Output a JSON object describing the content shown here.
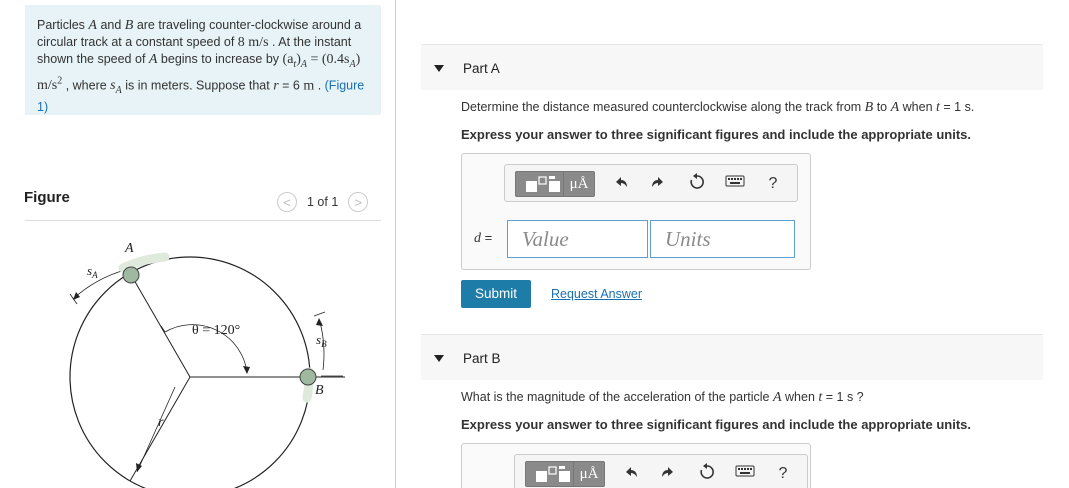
{
  "problem": {
    "t1": "Particles ",
    "A": "A",
    "t2": " and ",
    "B": "B",
    "t3": " are traveling counter-clockwise around a circular track at a constant speed of ",
    "speed": "8  m/s",
    "t4": " . At the instant shown the speed of ",
    "A2": "A",
    "t5": " begins to increase by ",
    "eq": "(a",
    "eq_sub": "t",
    "eq2": ")",
    "eq_sub2": "A",
    "eq3": " = (0.4s",
    "eq_sub3": "A",
    "eq4": ") m/s",
    "eq_sup": "2",
    "t6": " , where ",
    "sA": "s",
    "sA_sub": "A",
    "t7": " is in meters. Suppose that ",
    "r": "r",
    "t8": " = 6  ",
    "r_unit": "m",
    "t9": " . ",
    "figure_link": "(Figure 1)"
  },
  "figure": {
    "label": "Figure",
    "pager": "1 of 1",
    "prev_glyph": "<",
    "next_glyph": ">",
    "label_A": "A",
    "label_B": "B",
    "label_sA": "s",
    "label_sA_sub": "A",
    "label_sB": "s",
    "label_sB_sub": "B",
    "label_r": "r",
    "label_theta": "θ = 120°"
  },
  "part_a": {
    "title": "Part A",
    "q1": "Determine the distance measured counterclockwise along the track from ",
    "q_B": "B",
    "q2": " to ",
    "q_A": "A",
    "q3": " when ",
    "q_t": "t",
    "q4": " = 1 s.",
    "instruction": "Express your answer to three significant figures and include the appropriate units.",
    "var": "d",
    "var_eq": " =",
    "value_placeholder": "Value",
    "units_placeholder": "Units",
    "submit": "Submit",
    "request_answer": "Request Answer"
  },
  "part_b": {
    "title": "Part B",
    "q1": "What is the magnitude of the acceleration of the particle ",
    "q_A": "A",
    "q2": " when ",
    "q_t": "t",
    "q3": " = 1 s ?",
    "instruction": "Express your answer to three significant figures and include the appropriate units."
  },
  "toolbar": {
    "mu_label": "μÅ",
    "help": "?"
  },
  "colors": {
    "panel_bg": "#e7f3f6",
    "link": "#1a6fb0",
    "submit_bg": "#1d7ca8",
    "field_border": "#5c9fd0",
    "particle": "#9fb8a0"
  }
}
